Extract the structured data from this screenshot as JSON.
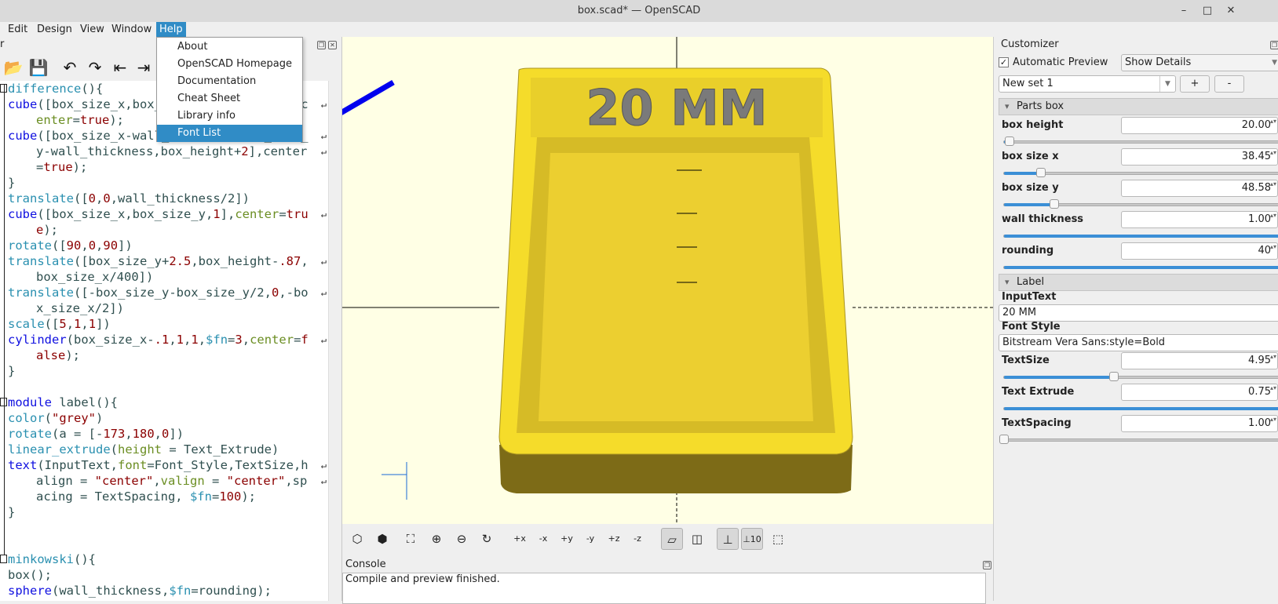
{
  "window": {
    "title": "box.scad* — OpenSCAD",
    "min": "–",
    "max": "□",
    "close": "✕"
  },
  "menu": [
    "Edit",
    "Design",
    "View",
    "Window",
    "Help"
  ],
  "help_menu": {
    "items": [
      "About",
      "OpenSCAD Homepage",
      "Documentation",
      "Cheat Sheet",
      "Library info",
      "Font List"
    ],
    "selected": "Font List"
  },
  "editor": {
    "title": "r",
    "lines": [
      [
        "0",
        "difference(){"
      ],
      [
        "0",
        "cube([box_size_x,box_size_y,box_height],c"
      ],
      [
        "1",
        "enter=true);"
      ],
      [
        "0",
        "cube([box_size_x-wall_thickness,box_size_"
      ],
      [
        "1",
        "y-wall_thickness,box_height+2],center"
      ],
      [
        "1",
        "=true);"
      ],
      [
        "0",
        "}"
      ],
      [
        "0",
        "translate([0,0,wall_thickness/2])"
      ],
      [
        "0",
        "cube([box_size_x,box_size_y,1],center=tru"
      ],
      [
        "1",
        "e);"
      ],
      [
        "0",
        "rotate([90,0,90])"
      ],
      [
        "0",
        "translate([box_size_y+2.5,box_height-.87,"
      ],
      [
        "1",
        "box_size_x/400])"
      ],
      [
        "0",
        "translate([-box_size_y-box_size_y/2,0,-bo"
      ],
      [
        "1",
        "x_size_x/2])"
      ],
      [
        "0",
        "scale([5,1,1])"
      ],
      [
        "0",
        "cylinder(box_size_x-.1,1,1,$fn=3,center=f"
      ],
      [
        "1",
        "alse);"
      ],
      [
        "0",
        "}"
      ],
      [
        "0",
        ""
      ],
      [
        "0",
        "module label(){"
      ],
      [
        "0",
        "color(\"grey\")"
      ],
      [
        "0",
        "rotate(a = [-173,180,0])"
      ],
      [
        "0",
        "linear_extrude(height = Text_Extrude)"
      ],
      [
        "0",
        "text(InputText,font=Font_Style,TextSize,h"
      ],
      [
        "1",
        "align = \"center\",valign = \"center\",sp"
      ],
      [
        "1",
        "acing = TextSpacing, $fn=100);"
      ],
      [
        "0",
        "}"
      ],
      [
        "0",
        ""
      ],
      [
        "0",
        ""
      ],
      [
        "0",
        "minkowski(){"
      ],
      [
        "0",
        "box();"
      ],
      [
        "0",
        "sphere(wall_thickness,$fn=rounding);"
      ]
    ]
  },
  "viewport": {
    "label_text": "20 MM",
    "accent": "#f0d030"
  },
  "console": {
    "title": "Console",
    "text": "Compile and preview finished."
  },
  "customizer": {
    "title": "Customizer",
    "auto_preview_label": "Automatic Preview",
    "auto_preview": true,
    "details": "Show Details",
    "preset": "New set 1",
    "add": "+",
    "remove": "-",
    "groups": [
      {
        "name": "Parts box",
        "params": [
          {
            "label": "box height",
            "value": "20.00",
            "slider": 0.02
          },
          {
            "label": "box size x",
            "value": "38.45",
            "slider": 0.13
          },
          {
            "label": "box size y",
            "value": "48.58",
            "slider": 0.18
          },
          {
            "label": "wall thickness",
            "value": "1.00",
            "slider": 1.0
          },
          {
            "label": "rounding",
            "value": "40",
            "slider": 1.0
          }
        ]
      },
      {
        "name": "Label",
        "text_params": [
          {
            "label": "InputText",
            "value": "20 MM"
          },
          {
            "label": "Font Style",
            "value": "Bitstream Vera Sans:style=Bold"
          }
        ],
        "params": [
          {
            "label": "TextSize",
            "value": "4.95",
            "slider": 0.39
          },
          {
            "label": "Text Extrude",
            "value": "0.75",
            "slider": 1.0
          },
          {
            "label": "TextSpacing",
            "value": "1.00",
            "slider": 0.0
          }
        ]
      }
    ]
  }
}
